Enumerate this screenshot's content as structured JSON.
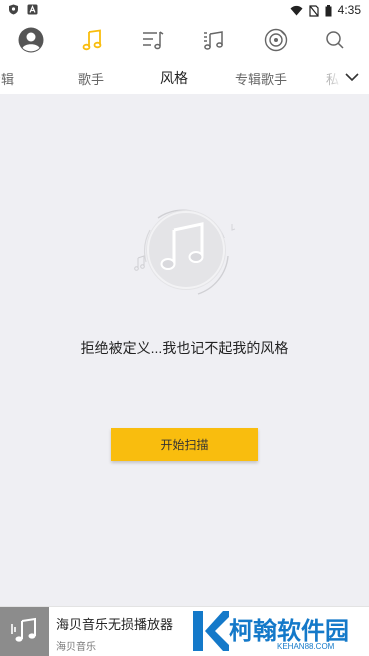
{
  "status_bar": {
    "left_icons": [
      "shield-icon",
      "a-box-icon"
    ],
    "right_icons": [
      "wifi-icon",
      "no-sim-icon",
      "battery-icon"
    ],
    "time": "4:35"
  },
  "top_nav": {
    "items": [
      {
        "name": "avatar",
        "icon": "avatar-icon"
      },
      {
        "name": "music",
        "icon": "music-note-icon",
        "active": true
      },
      {
        "name": "playlist",
        "icon": "playlist-icon"
      },
      {
        "name": "local-music",
        "icon": "music-list-icon"
      },
      {
        "name": "radio",
        "icon": "disc-radio-icon"
      },
      {
        "name": "search",
        "icon": "search-icon"
      }
    ],
    "accent_color": "#f9bd0e"
  },
  "tabs": {
    "items": [
      "专辑",
      "歌手",
      "风格",
      "专辑歌手",
      "私"
    ],
    "active": "风格",
    "more_icon": "chevron-down-icon"
  },
  "empty_state": {
    "icon": "music-disc-icon",
    "message": "拒绝被定义...我也记不起我的风格",
    "button_label": "开始扫描",
    "button_color": "#f9bd0e"
  },
  "player": {
    "cover_icon": "music-note-icon",
    "title": "海贝音乐无损播放器",
    "artist": "海贝音乐"
  },
  "watermark": {
    "name": "柯翰软件园",
    "url": "KEHAN88.COM",
    "color": "#1479c9"
  }
}
